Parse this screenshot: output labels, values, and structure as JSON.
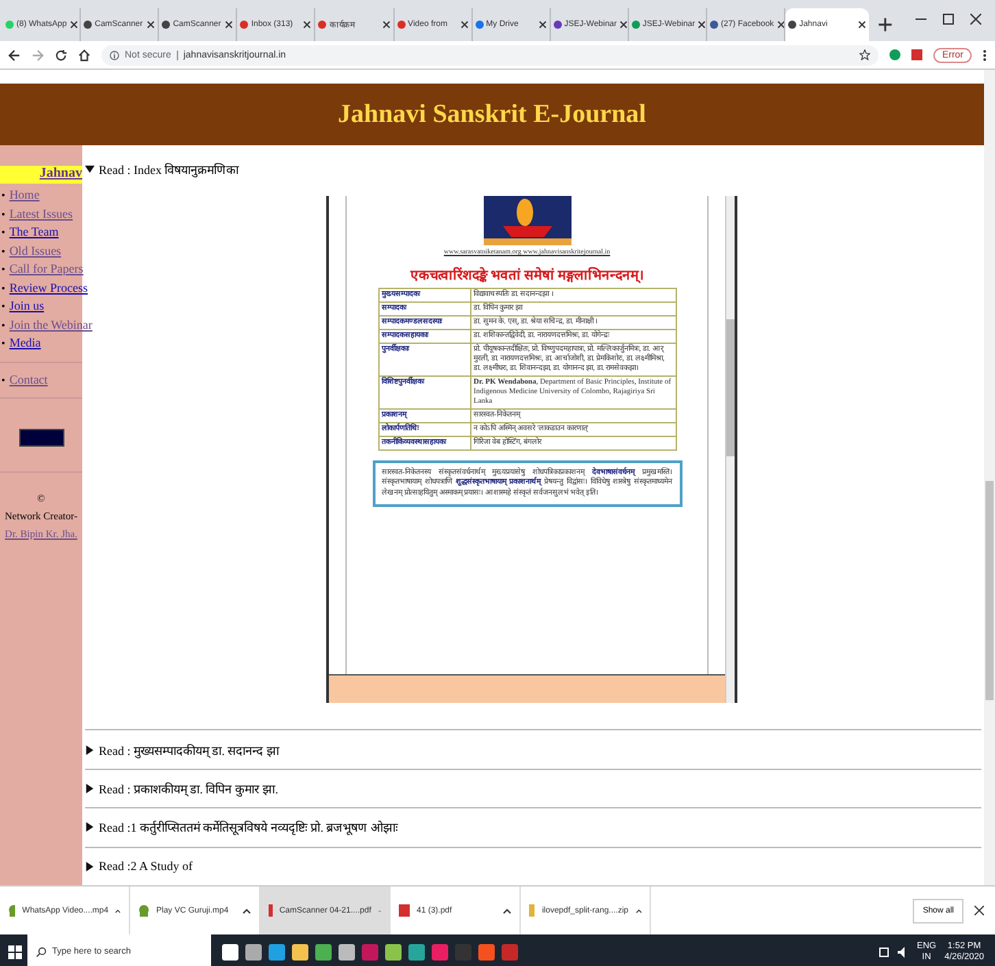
{
  "browser": {
    "tabs": [
      {
        "title": "(8) WhatsApp",
        "selected": false,
        "color": "#25d366"
      },
      {
        "title": "CamScanner",
        "selected": false,
        "color": "#444444"
      },
      {
        "title": "CamScanner",
        "selected": false,
        "color": "#444444"
      },
      {
        "title": "Inbox (313)",
        "selected": false,
        "color": "#d93025"
      },
      {
        "title": "कार्यक्रम",
        "selected": false,
        "color": "#d93025"
      },
      {
        "title": "Video from",
        "selected": false,
        "color": "#d93025"
      },
      {
        "title": "My Drive",
        "selected": false,
        "color": "#1a73e8"
      },
      {
        "title": "JSEJ-Webinar",
        "selected": false,
        "color": "#673ab7"
      },
      {
        "title": "JSEJ-Webinar",
        "selected": false,
        "color": "#0f9d58"
      },
      {
        "title": "(27) Facebook",
        "selected": false,
        "color": "#3b5998"
      },
      {
        "title": "Jahnavi",
        "selected": true,
        "color": "#444444"
      }
    ],
    "security": "Not secure",
    "url": "jahnavisanskritjournal.in",
    "profile": "Error"
  },
  "page": {
    "banner_title": "Jahnavi Sanskrit E-Journal",
    "marquee": "Jahnav",
    "sidebar": {
      "marker": "•",
      "nav": [
        {
          "label": "Home",
          "visited": true
        },
        {
          "label": "Latest Issues",
          "visited": true
        },
        {
          "label": "The Team",
          "visited": false
        },
        {
          "label": "Old Issues",
          "visited": true
        },
        {
          "label": "Call for Papers",
          "visited": true
        },
        {
          "label": "Review Process",
          "visited": false
        },
        {
          "label": "Join us",
          "visited": false
        },
        {
          "label": "Join the Webinar",
          "visited": true
        },
        {
          "label": "Media",
          "visited": false
        }
      ],
      "contact": [
        {
          "label": "Contact",
          "visited": true
        }
      ],
      "copyright": "©",
      "credit": "Network Creator-",
      "author": "Dr. Bipin Kr. Jha."
    },
    "index": {
      "label": "Read : Index विषयानुक्रमणिका",
      "expanded": true
    },
    "document": {
      "links": "www.sarasvatniketanam.org www.jahnavisanskritejournal.in",
      "heading": "एकचत्वारिंशदङ्के भवतां समेषां मङ्गलाभिनन्दनम्।",
      "rows": [
        {
          "role": "मुख्यसम्पादकः",
          "names": "विद्यावाचस्पतिः डा. सदानन्दझा ।"
        },
        {
          "role": "सम्पादकः",
          "names": "डा. विपिन कुमार झा"
        },
        {
          "role": "सम्पादकमण्डलसदस्याः",
          "names": "डा. सुमन के. एस्, डा. श्रेया सचिन्द्र, डा. मीनाक्षी ।"
        },
        {
          "role": "सम्पादकसहायकाः",
          "names": "डा. शशिकान्तद्विवेदी, डा. नारायणदत्तमिश्रः, डा. योगेन्द्रः"
        },
        {
          "role": "पुनर्वीक्षकाः",
          "names": "प्रो. पीयूषकान्तदीक्षितः, प्रो. विष्णुपदमहापात्रः, प्रो. मल्लिकार्जुनमित्रः, डा. आर् मुरली, डा. नारायणदत्तमिश्रः, डा. आर्चाजोशी, डा. प्रेमकिशोरः, डा. लक्ष्मीमिश्रा, डा. लक्ष्मीधरः, डा. शिवानन्दझा, डा. योगानन्द झा, डा. रामसेवकझा।"
        },
        {
          "role": "विशिष्टपुनर्वीक्षकः",
          "names": "**Dr. PK Wendabona**, Department of Basic Principles, Institute of Indigenous Medicine University of Colombo, Rajagiriya Sri Lanka"
        },
        {
          "role": "प्रकाशनम्",
          "names": "सारस्वत-निकेतनम्"
        },
        {
          "role": "लोकार्पणतिथिः",
          "names": "न कोऽपि अस्मिन् अवसरे 'लाकडाउन कारणात्'"
        },
        {
          "role": "तकनीकिव्यवस्थासहायकः",
          "names": "गिरिजा वेब होस्टिंग, बंगलोर"
        }
      ],
      "notice": "सारस्वत-निकेतनस्य संस्कृतसंवर्धनार्थम् मुख्यप्रयासेषु शोधपत्रिकाप्रकाशनम् **देवभाषासंवर्धनम्** प्रमुखमस्ति। संस्कृतभाषायाम् शोधपत्राणि **शुद्धसंस्कृतभाषायाम् प्रकाशनार्थम्** प्रेषयन्तु विद्वांसः। विविधेषु शास्त्रेषु संस्कृतमाध्यमेन लेखनम् प्रोत्साहयितुम् अस्माकम् प्रयासः। आशास्महे संस्कृतं सर्वजनसुलभं भवेत् इति।"
    },
    "entries": [
      {
        "label": "Read : मुख्यसम्पादकीयम् डा. सदानन्द झा",
        "expanded": false
      },
      {
        "label": "Read : प्रकाशकीयम् डा. विपिन कुमार झा.",
        "expanded": false
      },
      {
        "label": "Read :1 कर्तुरीप्सिततमं कर्मेतिसूत्रविषये नव्यदृष्टिः प्रो. ब्रजभूषण ओझाः",
        "expanded": false
      },
      {
        "label": "Read :2 A Study of",
        "expanded": false
      }
    ]
  },
  "downloads": {
    "items": [
      {
        "name": "WhatsApp Video....mp4",
        "kind": "video",
        "selected": false
      },
      {
        "name": "Play VC Guruji.mp4",
        "kind": "video",
        "selected": false
      },
      {
        "name": "CamScanner 04-21....pdf",
        "kind": "pdf",
        "selected": true
      },
      {
        "name": "41 (3).pdf",
        "kind": "pdf",
        "selected": false
      },
      {
        "name": "ilovepdf_split-rang....zip",
        "kind": "zip",
        "selected": false
      }
    ],
    "show_all": "Show all"
  },
  "taskbar": {
    "search_placeholder": "Type here to search",
    "lang": "ENG",
    "region": "IN",
    "time": "1:52 PM",
    "date": "4/26/2020"
  }
}
